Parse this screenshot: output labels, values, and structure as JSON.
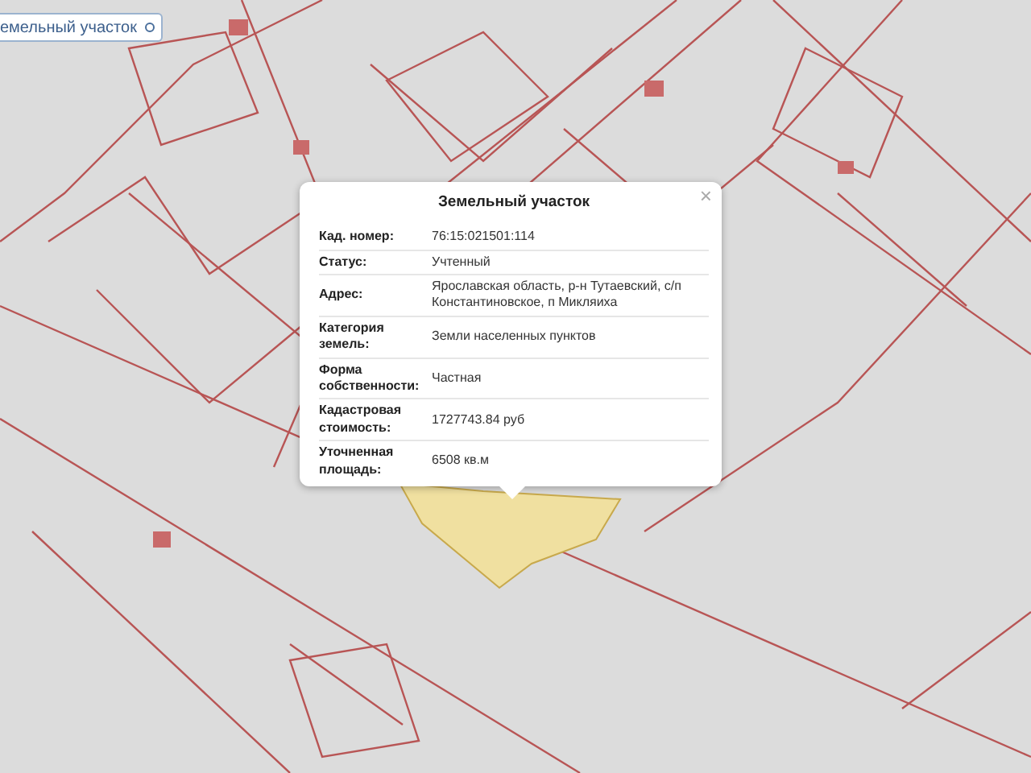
{
  "layer_select": {
    "value": "емельный участок"
  },
  "popup": {
    "title": "Земельный участок",
    "close": "×",
    "rows": [
      {
        "label": "Кад. номер:",
        "value": "76:15:021501:114"
      },
      {
        "label": "Статус:",
        "value": "Учтенный"
      },
      {
        "label": "Адрес:",
        "value": "Ярославская область, р-н Тутаевский, с/п Константиновское, п Микляиха"
      },
      {
        "label": "Категория земель:",
        "value": "Земли населенных пунктов"
      },
      {
        "label": "Форма собственности:",
        "value": "Частная"
      },
      {
        "label": "Кадастровая стоимость:",
        "value": "1727743.84 руб"
      },
      {
        "label": "Уточненная площадь:",
        "value": "6508 кв.м"
      }
    ]
  }
}
